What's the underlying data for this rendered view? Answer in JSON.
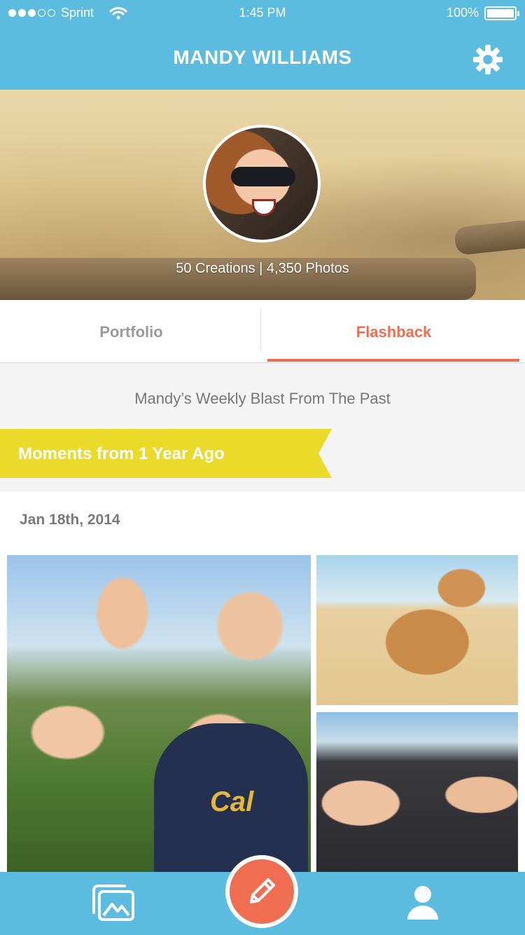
{
  "status_bar": {
    "carrier": "Sprint",
    "time": "1:45 PM",
    "battery": "100%",
    "signal_icon": "signal-dots-icon",
    "wifi_icon": "wifi-icon",
    "battery_icon": "battery-icon",
    "battery_level": 1.0
  },
  "nav": {
    "title": "MANDY WILLIAMS",
    "settings_icon": "gear-icon"
  },
  "profile": {
    "stats": "50 Creations | 4,350 Photos",
    "avatar": "avatar"
  },
  "tabs": [
    {
      "label": "Portfolio",
      "selected": false
    },
    {
      "label": "Flashback",
      "selected": true
    }
  ],
  "flashback": {
    "subtitle": "Mandy’s Weekly Blast From The Past",
    "banner": "Moments from 1 Year Ago",
    "date": "Jan 18th, 2014"
  },
  "bottom_bar": {
    "gallery_icon": "gallery-icon",
    "create_icon": "pencil-icon",
    "profile_icon": "profile-icon"
  },
  "colors": {
    "header_blue": "#5bbcdf",
    "accent_coral": "#ef6e52",
    "banner_yellow": "#eada2a"
  }
}
